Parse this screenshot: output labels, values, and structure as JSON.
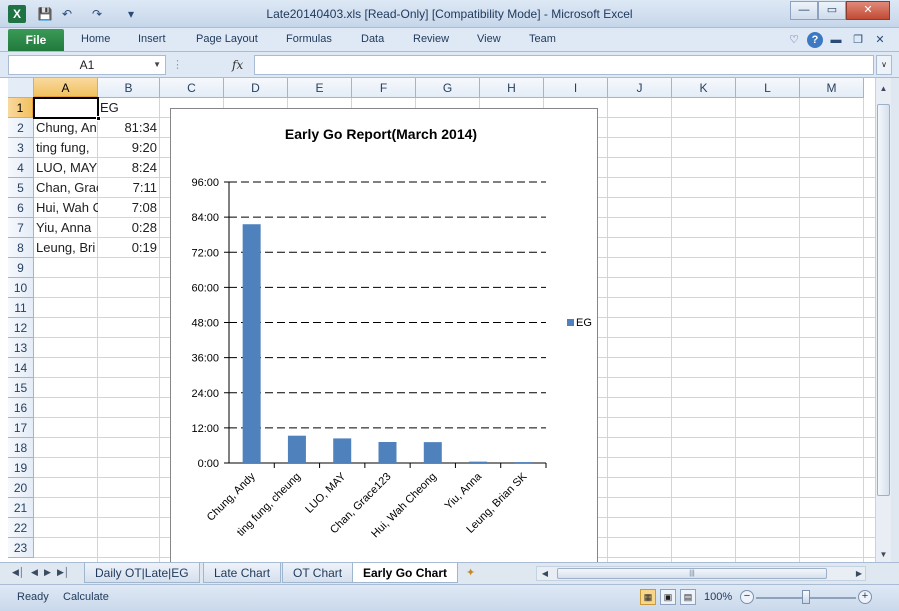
{
  "window": {
    "title": "Late20140403.xls  [Read-Only]  [Compatibility Mode]  -  Microsoft Excel",
    "app_icon": "X",
    "minimize": "—",
    "restore": "▭",
    "close": "✕"
  },
  "quick_access": {
    "save_icon": "save-icon",
    "undo_icon": "undo-icon",
    "redo_icon": "redo-icon",
    "customize_icon": "customize-icon"
  },
  "ribbon": {
    "file": "File",
    "tabs": [
      "Home",
      "Insert",
      "Page Layout",
      "Formulas",
      "Data",
      "Review",
      "View",
      "Team"
    ],
    "help": "?"
  },
  "formula_bar": {
    "name_box": "A1",
    "fx": "fx",
    "value": ""
  },
  "grid": {
    "columns": [
      "A",
      "B",
      "C",
      "D",
      "E",
      "F",
      "G",
      "H",
      "I",
      "J",
      "K",
      "L",
      "M"
    ],
    "rows": [
      "1",
      "2",
      "3",
      "4",
      "5",
      "6",
      "7",
      "8",
      "9",
      "10",
      "11",
      "12",
      "13",
      "14",
      "15",
      "16",
      "17",
      "18",
      "19",
      "20",
      "21",
      "22",
      "23"
    ],
    "selected_column": "A",
    "selected_row": "1",
    "header_b1": "EG",
    "names": [
      "Chung, Andy",
      "ting fung, cheung",
      "LUO, MAY",
      "Chan, Grace123",
      "Hui, Wah Cheong",
      "Yiu, Anna",
      "Leung, Brian SK"
    ],
    "names_visible": [
      "Chung, An",
      "ting fung,",
      "LUO, MAY",
      "Chan, Grac",
      "Hui, Wah C",
      "Yiu, Anna",
      "Leung, Bri"
    ],
    "values": [
      "81:34",
      "9:20",
      "8:24",
      "7:11",
      "7:08",
      "0:28",
      "0:19"
    ]
  },
  "chart_data": {
    "type": "bar",
    "title": "Early Go Report(March 2014)",
    "categories": [
      "Chung, Andy",
      "ting fung, cheung",
      "LUO, MAY",
      "Chan, Grace123",
      "Hui, Wah Cheong",
      "Yiu, Anna",
      "Leung, Brian SK"
    ],
    "series": [
      {
        "name": "EG",
        "values": [
          81.57,
          9.33,
          8.4,
          7.18,
          7.13,
          0.47,
          0.32
        ]
      }
    ],
    "y_ticks": [
      "0:00",
      "12:00",
      "24:00",
      "36:00",
      "48:00",
      "60:00",
      "72:00",
      "84:00",
      "96:00"
    ],
    "ylim": [
      0,
      96
    ],
    "grid": true,
    "legend": "right",
    "color": "#4f81bd"
  },
  "sheets": {
    "tabs": [
      "Daily OT|Late|EG",
      "Late Chart",
      "OT Chart",
      "Early Go Chart"
    ],
    "active": "Early Go Chart"
  },
  "status": {
    "mode": "Ready",
    "calc": "Calculate",
    "zoom": "100%"
  }
}
